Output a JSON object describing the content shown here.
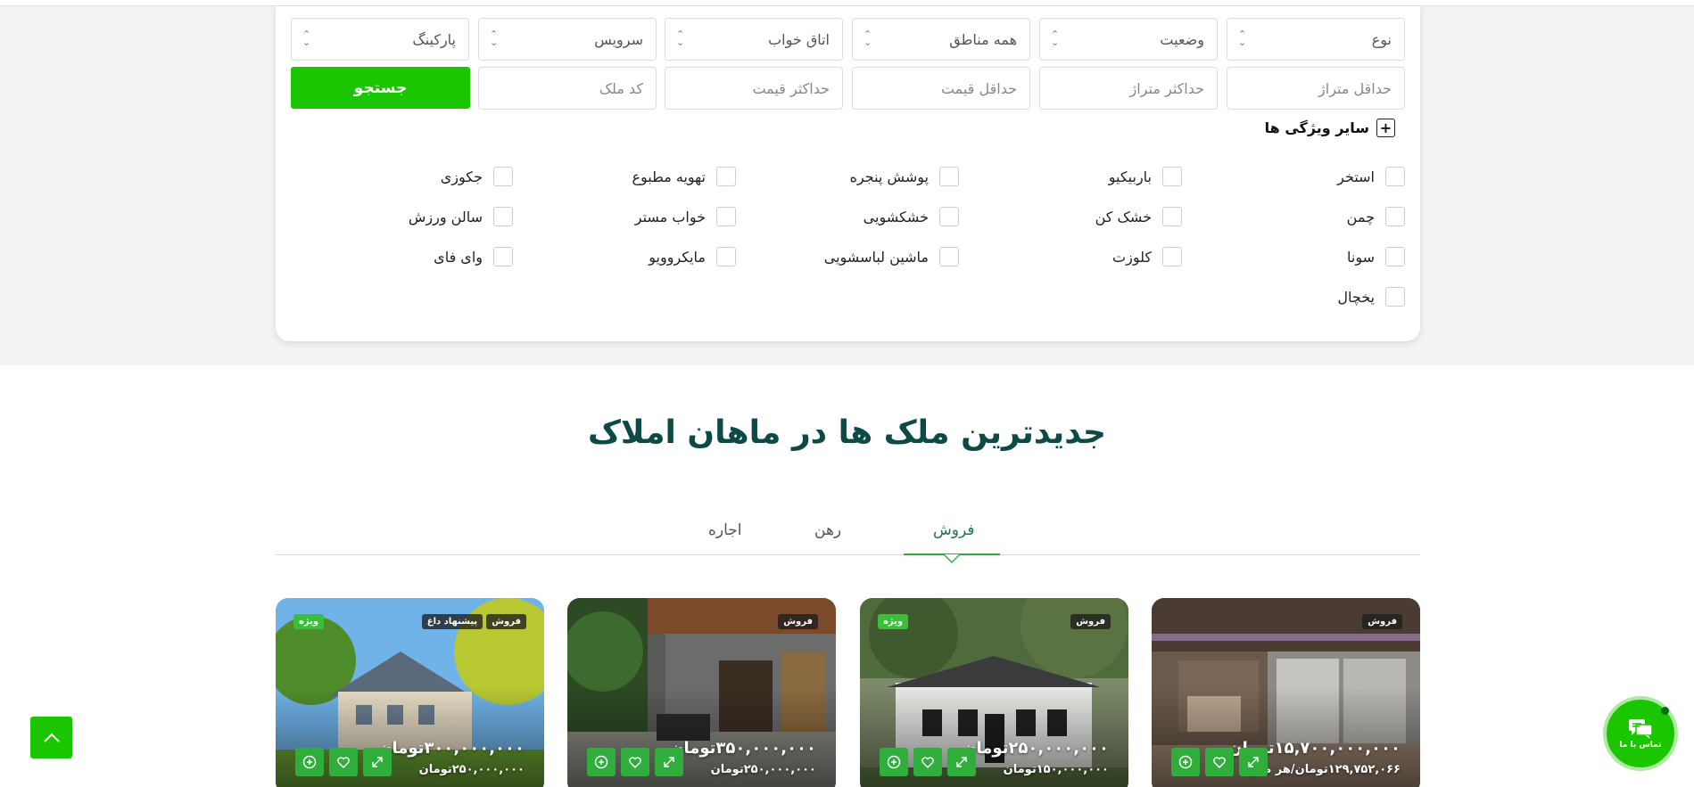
{
  "filters": {
    "row1": [
      {
        "name": "type-select",
        "label": "نوع"
      },
      {
        "name": "status-select",
        "label": "وضعیت"
      },
      {
        "name": "region-select",
        "label": "همه مناطق"
      },
      {
        "name": "bedroom-select",
        "label": "اتاق خواب"
      },
      {
        "name": "service-select",
        "label": "سرویس"
      },
      {
        "name": "parking-select",
        "label": "پارکینگ"
      }
    ],
    "row2": [
      {
        "name": "min-area-input",
        "placeholder": "حداقل متراژ"
      },
      {
        "name": "max-area-input",
        "placeholder": "حداکثر متراژ"
      },
      {
        "name": "min-price-input",
        "placeholder": "حداقل قیمت"
      },
      {
        "name": "max-price-input",
        "placeholder": "حداکثر قیمت"
      },
      {
        "name": "property-code-input",
        "placeholder": "کد ملک"
      }
    ],
    "search_label": "جستجو",
    "more_features_label": "سایر ویژگی ها",
    "features": [
      "استخر",
      "باربیکیو",
      "پوشش پنجره",
      "تهویه مطبوع",
      "جکوزی",
      "چمن",
      "خشک کن",
      "خشکشویی",
      "خواب مستر",
      "سالن ورزش",
      "سونا",
      "کلوزت",
      "ماشین لباسشویی",
      "مایکروویو",
      "وای فای",
      "یخچال"
    ]
  },
  "section": {
    "heading": "جدیدترین ملک ها در ماهان املاک",
    "tabs": [
      "فروش",
      "رهن",
      "اجاره"
    ],
    "active_tab": "فروش"
  },
  "cards": [
    {
      "badges_left": [],
      "badges_right": [
        "فروش"
      ],
      "price": "۱۵,۷۰۰,۰۰۰,۰۰۰تومان",
      "sub": "۱۲۹,۷۵۲,۰۶۶تومان/هر متر"
    },
    {
      "badges_left": [
        "ویژه"
      ],
      "badges_right": [
        "فروش"
      ],
      "price": "۲۵۰,۰۰۰,۰۰۰تومان",
      "sub": "۱۵۰,۰۰۰,۰۰۰تومان"
    },
    {
      "badges_left": [],
      "badges_right": [
        "فروش"
      ],
      "price": "۳۵۰,۰۰۰,۰۰۰تومان",
      "sub": "۲۵۰,۰۰۰,۰۰۰تومان"
    },
    {
      "badges_left": [
        "ویژه"
      ],
      "badges_right": [
        "فروش",
        "پیشنهاد داغ"
      ],
      "price": "۳۰۰,۰۰۰,۰۰۰تومان",
      "sub": "۲۵۰,۰۰۰,۰۰۰تومان"
    }
  ],
  "chat_label": "تماس با ما",
  "colors": {
    "accent": "#1bc600",
    "heading": "#0d4a45",
    "tab_active": "#1f7a4f"
  }
}
